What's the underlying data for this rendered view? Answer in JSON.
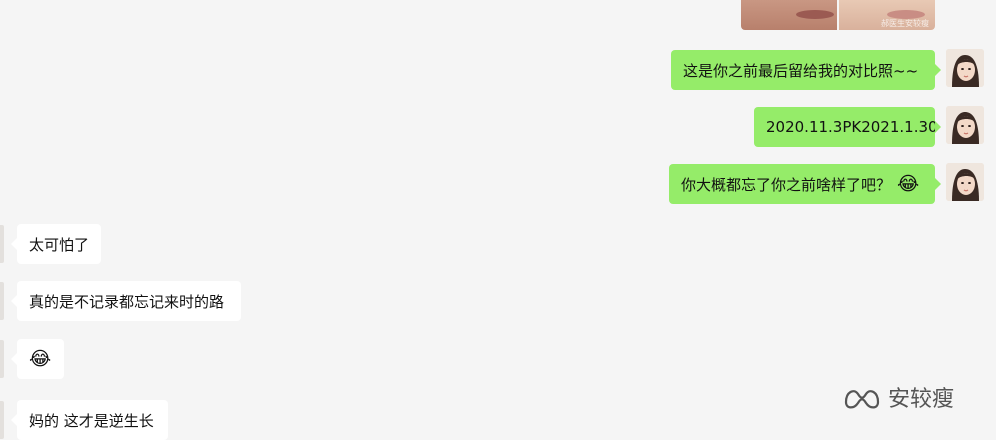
{
  "photo": {
    "watermark": "郝医生安较瘦"
  },
  "outgoing": [
    {
      "text": "这是你之前最后留给我的对比照~~",
      "emoji": ""
    },
    {
      "text": "2020.11.3PK2021.1.30",
      "emoji": ""
    },
    {
      "text": "你大概都忘了你之前啥样了吧？",
      "emoji": "😂"
    }
  ],
  "incoming": [
    {
      "text": "太可怕了",
      "emoji": ""
    },
    {
      "text": "真的是不记录都忘记来时的路",
      "emoji": ""
    },
    {
      "text": "",
      "emoji": "😂"
    },
    {
      "text": "妈的 这才是逆生长",
      "emoji": ""
    }
  ],
  "watermark": {
    "text": "安较瘦",
    "icon": "wechat-channel-icon"
  }
}
